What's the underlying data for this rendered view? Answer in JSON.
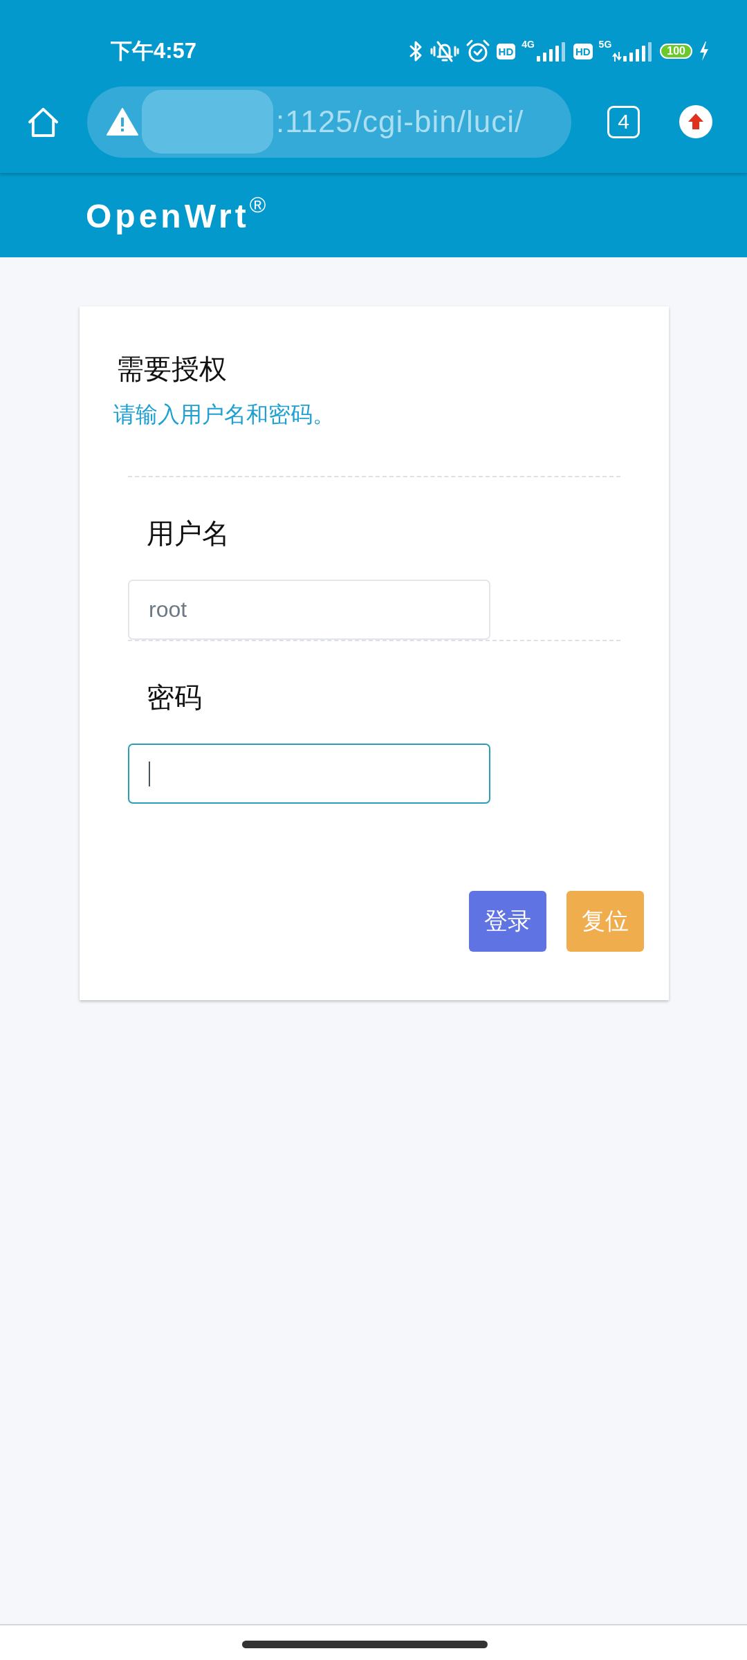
{
  "status_bar": {
    "time": "下午4:57",
    "networks": [
      {
        "badge": "HD",
        "generation": "4G",
        "kind": "plain"
      },
      {
        "badge": "HD",
        "generation": "5G",
        "kind": "activity"
      }
    ],
    "battery": "100"
  },
  "browser_bar": {
    "url": ":1125/cgi-bin/luci/",
    "tab_count": "4"
  },
  "header": {
    "brand": "OpenWrt$^{®}$"
  },
  "login": {
    "title": "需要授权",
    "subtitle": "请输入用户名和密码。",
    "fields": [
      {
        "label": "用户名",
        "value": "root",
        "focused": false
      },
      {
        "label": "密码",
        "focused": true
      }
    ],
    "buttons": [
      {
        "label": "登录",
        "kind": "submit"
      },
      {
        "label": "复位",
        "kind": "reset"
      }
    ]
  }
}
